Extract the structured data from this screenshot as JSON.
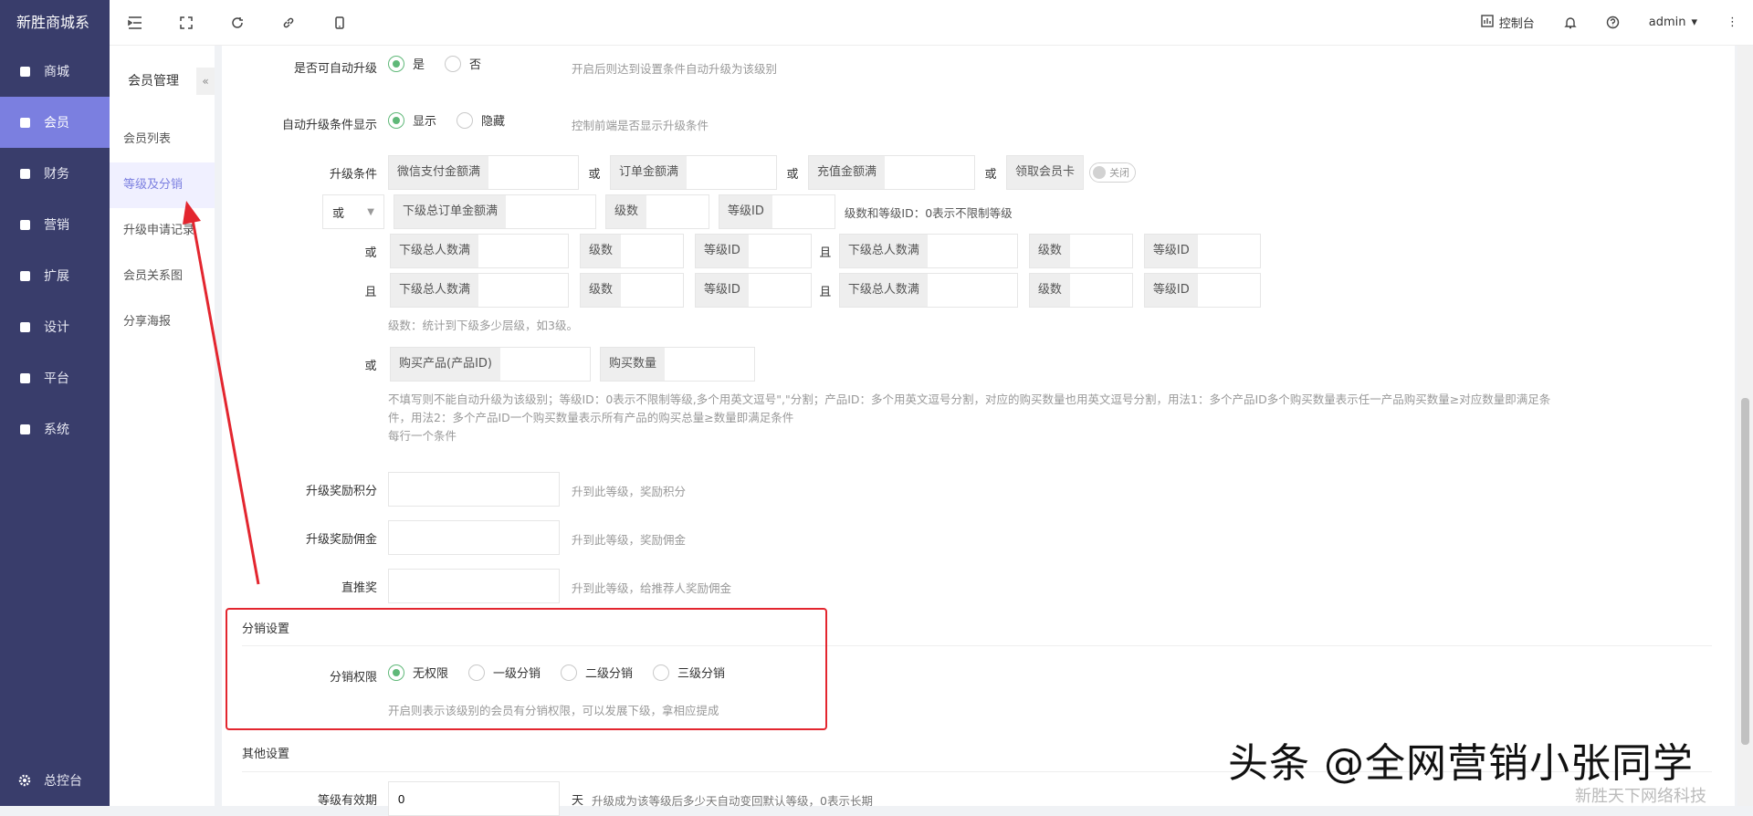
{
  "brand": "新胜商城系",
  "nav": {
    "items": [
      {
        "label": "商城",
        "icon": "mall-icon"
      },
      {
        "label": "会员",
        "icon": "member-icon",
        "active": true
      },
      {
        "label": "财务",
        "icon": "finance-icon"
      },
      {
        "label": "营销",
        "icon": "marketing-icon"
      },
      {
        "label": "扩展",
        "icon": "extension-icon"
      },
      {
        "label": "设计",
        "icon": "design-icon"
      },
      {
        "label": "平台",
        "icon": "platform-icon"
      },
      {
        "label": "系统",
        "icon": "system-icon"
      }
    ],
    "bottom": "总控台"
  },
  "submenu": {
    "title": "会员管理",
    "collapse": "«",
    "items": [
      "会员列表",
      "等级及分销",
      "升级申请记录",
      "会员关系图",
      "分享海报"
    ]
  },
  "topbar": {
    "console": "控制台",
    "user": "admin",
    "icons": [
      "menu-fold-icon",
      "fullscreen-icon",
      "refresh-icon",
      "link-icon",
      "mobile-icon"
    ]
  },
  "form": {
    "auto_upgrade": {
      "label": "是否可自动升级",
      "yes": "是",
      "no": "否",
      "hint": "开启后则达到设置条件自动升级为该级别"
    },
    "cond_display": {
      "label": "自动升级条件显示",
      "show": "显示",
      "hide": "隐藏",
      "hint": "控制前端是否显示升级条件"
    },
    "conditions": {
      "label": "升级条件",
      "wx": "微信支付金额满",
      "order": "订单金额满",
      "recharge": "充值金额满",
      "card": "领取会员卡",
      "toggle": "关闭",
      "or": "或",
      "and": "且",
      "select": "或",
      "sub_total": "下级总订单金额满",
      "level_num": "级数",
      "level_id": "等级ID",
      "level_hint": "级数和等级ID：0表示不限制等级",
      "sub_people": "下级总人数满",
      "level_note": "级数：统计到下级多少层级，如3级。",
      "buy_product": "购买产品(产品ID)",
      "buy_qty": "购买数量",
      "note1": "不填写则不能自动升级为该级别；等级ID：0表示不限制等级,多个用英文逗号\",\"分割；产品ID：多个用英文逗号分割，对应的购买数量也用英文逗号分割，用法1：多个产品ID多个购买数量表示任一产品购买数量≥对应数量即满足条",
      "note2": "件，用法2：多个产品ID一个购买数量表示所有产品的购买总量≥数量即满足条件",
      "note3": "每行一个条件"
    },
    "reward_points": {
      "label": "升级奖励积分",
      "hint": "升到此等级，奖励积分"
    },
    "reward_commission": {
      "label": "升级奖励佣金",
      "hint": "升到此等级，奖励佣金"
    },
    "direct": {
      "label": "直推奖",
      "hint": "升到此等级，给推荐人奖励佣金"
    },
    "dist_section": "分销设置",
    "dist": {
      "label": "分销权限",
      "options": [
        "无权限",
        "一级分销",
        "二级分销",
        "三级分销"
      ],
      "hint": "开启则表示该级别的会员有分销权限，可以发展下级，拿相应提成"
    },
    "other_section": "其他设置",
    "validity": {
      "label": "等级有效期",
      "value": "0",
      "unit": "天",
      "hint": "升级成为该等级后多少天自动变回默认等级，0表示长期"
    }
  },
  "watermark": "头条 @全网营销小张同学",
  "watermark2": "新胜天下网络科技",
  "colors": {
    "sidebar": "#393d6b",
    "active": "#7b7fe0",
    "radio": "#5fb878",
    "highlight": "#e3262f"
  }
}
